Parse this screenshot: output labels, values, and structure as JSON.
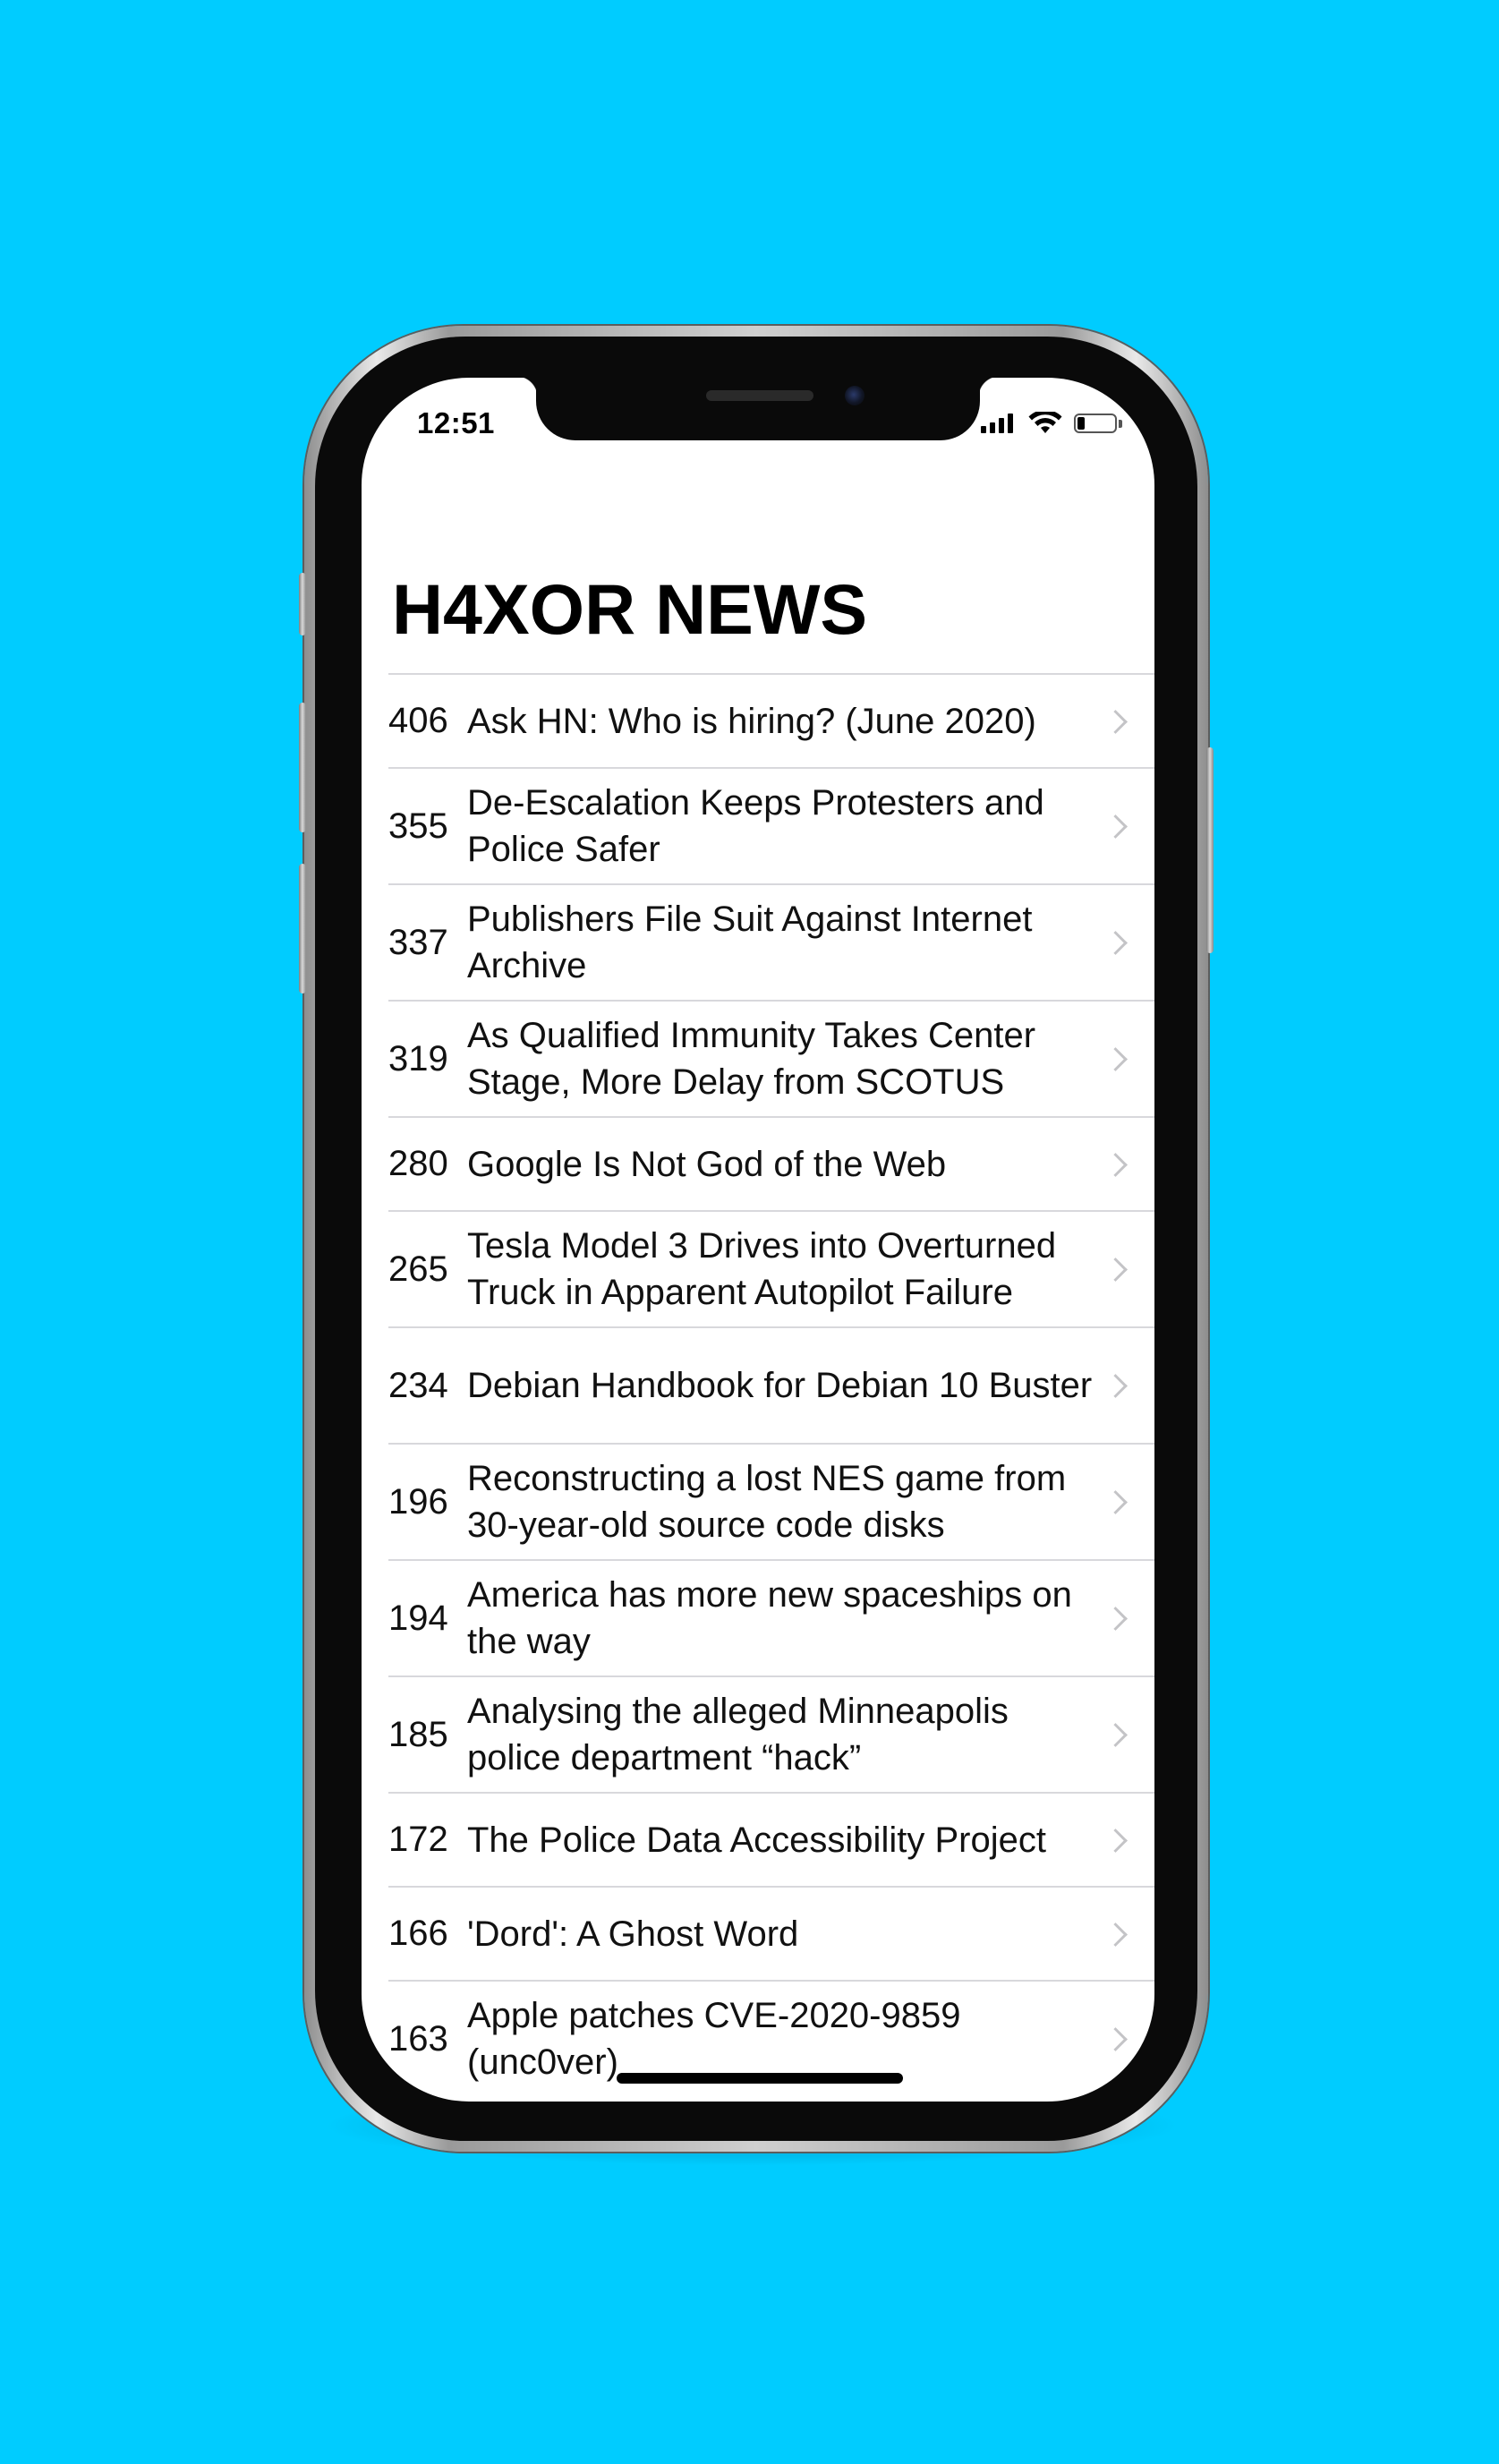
{
  "status_bar": {
    "time": "12:51"
  },
  "header": {
    "title": "H4XOR NEWS"
  },
  "stories": [
    {
      "points": "406",
      "title": "Ask HN: Who is hiring? (June 2020)"
    },
    {
      "points": "355",
      "title": "De-Escalation Keeps Protesters and Police Safer"
    },
    {
      "points": "337",
      "title": "Publishers File Suit Against Internet Archive"
    },
    {
      "points": "319",
      "title": "As Qualified Immunity Takes Center Stage, More Delay from SCOTUS"
    },
    {
      "points": "280",
      "title": "Google Is Not God of the Web"
    },
    {
      "points": "265",
      "title": "Tesla Model 3 Drives into Overturned Truck in Apparent Autopilot Failure"
    },
    {
      "points": "234",
      "title": "Debian Handbook for Debian 10 Buster"
    },
    {
      "points": "196",
      "title": "Reconstructing a lost NES game from 30-year-old source code disks"
    },
    {
      "points": "194",
      "title": "America has more new spaceships on the way"
    },
    {
      "points": "185",
      "title": "Analysing the alleged Minneapolis police department “hack”"
    },
    {
      "points": "172",
      "title": "The Police Data Accessibility Project"
    },
    {
      "points": "166",
      "title": "'Dord': A Ghost Word"
    },
    {
      "points": "163",
      "title": "Apple patches CVE-2020-9859 (unc0ver)"
    }
  ],
  "colors": {
    "background": "#00ccff",
    "separator": "#d8d8dc",
    "chevron": "#c4c4c7",
    "text": "#111111"
  },
  "icons": {
    "signal": "cellular-signal-icon",
    "wifi": "wifi-icon",
    "battery": "battery-icon",
    "disclosure": "chevron-right-icon"
  },
  "battery_level": 0.2
}
